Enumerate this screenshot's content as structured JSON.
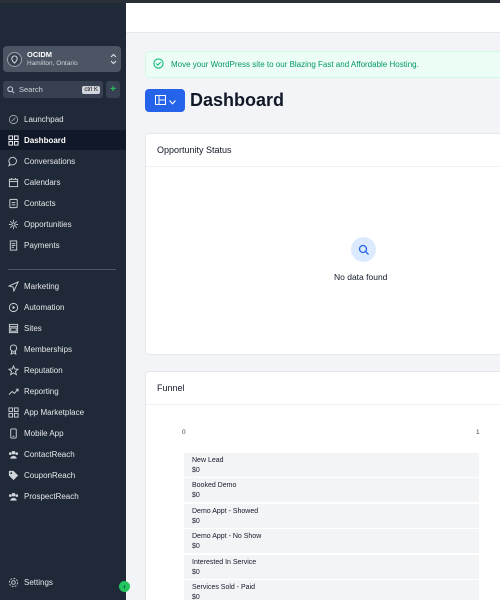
{
  "account": {
    "name": "OCIDM",
    "location": "Hamilton, Ontario"
  },
  "search": {
    "label": "Search",
    "shortcut": "ctrl K",
    "plus": "+"
  },
  "nav_primary": [
    {
      "label": "Launchpad",
      "icon": "rocket-icon"
    },
    {
      "label": "Dashboard",
      "icon": "dashboard-grid-icon",
      "active": true
    },
    {
      "label": "Conversations",
      "icon": "chat-icon"
    },
    {
      "label": "Calendars",
      "icon": "calendar-icon"
    },
    {
      "label": "Contacts",
      "icon": "contacts-icon"
    },
    {
      "label": "Opportunities",
      "icon": "opportunities-icon"
    },
    {
      "label": "Payments",
      "icon": "payments-icon"
    }
  ],
  "nav_secondary": [
    {
      "label": "Marketing",
      "icon": "send-icon"
    },
    {
      "label": "Automation",
      "icon": "automation-icon"
    },
    {
      "label": "Sites",
      "icon": "sites-icon"
    },
    {
      "label": "Memberships",
      "icon": "memberships-icon"
    },
    {
      "label": "Reputation",
      "icon": "star-icon"
    },
    {
      "label": "Reporting",
      "icon": "trend-icon"
    },
    {
      "label": "App Marketplace",
      "icon": "marketplace-icon"
    },
    {
      "label": "Mobile App",
      "icon": "mobile-icon"
    },
    {
      "label": "ContactReach",
      "icon": "group-icon"
    },
    {
      "label": "CouponReach",
      "icon": "tag-icon"
    },
    {
      "label": "ProspectReach",
      "icon": "group-icon"
    }
  ],
  "settings": {
    "label": "Settings"
  },
  "banner": {
    "text": "Move your WordPress site to our Blazing Fast and Affordable Hosting."
  },
  "page": {
    "title": "Dashboard"
  },
  "opportunity_status": {
    "title": "Opportunity Status",
    "empty": "No data found"
  },
  "funnel": {
    "title": "Funnel",
    "axis_min": "0",
    "axis_max": "1",
    "stages": [
      {
        "name": "New Lead",
        "value": "$0"
      },
      {
        "name": "Booked Demo",
        "value": "$0"
      },
      {
        "name": "Demo Appt - Showed",
        "value": "$0"
      },
      {
        "name": "Demo Appt - No Show",
        "value": "$0"
      },
      {
        "name": "Interested In Service",
        "value": "$0"
      },
      {
        "name": "Services Sold - Paid",
        "value": "$0"
      }
    ]
  },
  "colors": {
    "sidebar": "#1f2937",
    "accent": "#2563eb",
    "success": "#22c55e"
  }
}
